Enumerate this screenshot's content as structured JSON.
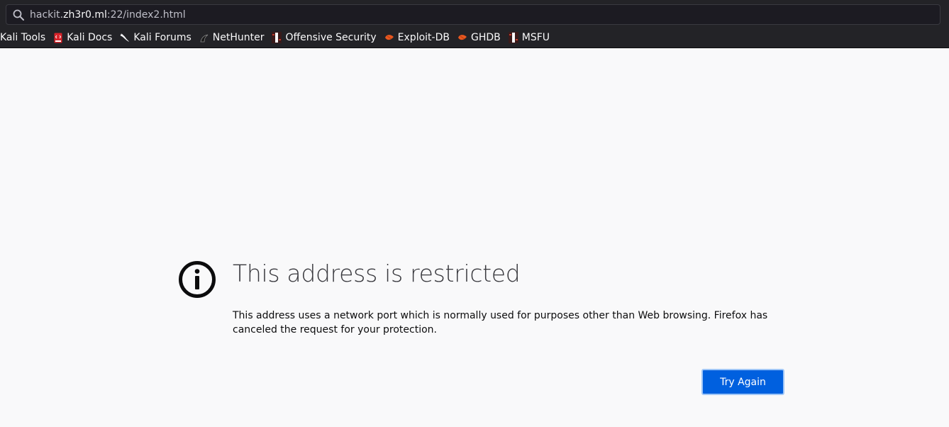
{
  "browser": {
    "url": {
      "prefix": "hackit.",
      "domain": "zh3r0.ml",
      "suffix": ":22/index2.html"
    },
    "bookmarks": [
      {
        "label": "Kali Tools",
        "icon": "none"
      },
      {
        "label": "Kali Docs",
        "icon": "kali-docs-icon"
      },
      {
        "label": "Kali Forums",
        "icon": "kali-dragon-icon"
      },
      {
        "label": "NetHunter",
        "icon": "nethunter-icon"
      },
      {
        "label": "Offensive Security",
        "icon": "offsec-icon"
      },
      {
        "label": "Exploit-DB",
        "icon": "exploit-db-icon"
      },
      {
        "label": "GHDB",
        "icon": "ghdb-icon"
      },
      {
        "label": "MSFU",
        "icon": "msfu-icon"
      }
    ]
  },
  "error_page": {
    "icon": "info-icon",
    "title": "This address is restricted",
    "description": "This address uses a network port which is normally used for purposes other than Web browsing. Firefox has canceled the request for your protection.",
    "button_label": "Try Again"
  },
  "colors": {
    "toolbar_bg": "#232327",
    "page_bg": "#f9f9fa",
    "button_blue": "#0060df",
    "exploit_orange": "#e8571f",
    "kali_docs_red": "#d8232a"
  }
}
